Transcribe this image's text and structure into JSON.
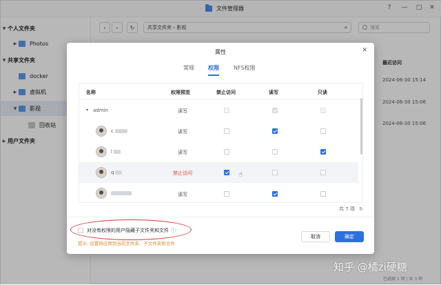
{
  "window": {
    "title": "文件管理器",
    "controls": [
      "?",
      "—",
      "□",
      "✕"
    ]
  },
  "sidebar": {
    "sections": [
      {
        "label": "个人文件夹",
        "items": [
          {
            "label": "Photos"
          }
        ]
      },
      {
        "label": "共享文件夹",
        "items": [
          {
            "label": "docker"
          },
          {
            "label": "虚拟机"
          },
          {
            "label": "影视",
            "selected": true
          },
          {
            "label": "回收站"
          }
        ]
      },
      {
        "label": "用户文件夹",
        "items": []
      }
    ]
  },
  "toolbar": {
    "path": "共享文件夹 › 影视",
    "search_placeholder": "搜索"
  },
  "file_list": {
    "column_recent": "最近访问",
    "rows": [
      "2024-06-30 15:14",
      "2024-06-30 15:06",
      "2024-06-30 15:06"
    ],
    "status": "已选择 1 项 | 共 3 项"
  },
  "dialog": {
    "title": "属性",
    "tabs": [
      {
        "label": "常规"
      },
      {
        "label": "权限",
        "active": true
      },
      {
        "label": "NFS权限"
      }
    ],
    "columns": [
      "名称",
      "权限预览",
      "禁止访问",
      "读写",
      "只读"
    ],
    "rows": [
      {
        "name": "admin",
        "group": true,
        "preview": "读写",
        "deny": "disabled",
        "rw": "checked-disabled",
        "ro": "disabled"
      },
      {
        "name": "c",
        "preview": "读写",
        "deny": "off",
        "rw": "on",
        "ro": "off"
      },
      {
        "name": "l",
        "preview": "读写",
        "deny": "off",
        "rw": "off",
        "ro": "on"
      },
      {
        "name": "q",
        "preview": "禁止访问",
        "deny": "on",
        "rw": "off",
        "ro": "off",
        "highlight": true
      },
      {
        "name": "",
        "preview": "读写",
        "deny": "off",
        "rw": "on",
        "ro": "off"
      }
    ],
    "total": "共 7 项",
    "hide_option": "对没有权限的用户隐藏子文件夹和文件",
    "hint": "提示: 设置将应用到当前文件夹、子文件夹和文件",
    "cancel_label": "取消",
    "ok_label": "确定"
  },
  "watermark": "知乎 @橘zi硬糖",
  "colors": {
    "accent": "#2c6fe0",
    "deny_text": "#e04b3a",
    "hint": "#e08a2a",
    "annotation": "#d23a3a"
  }
}
